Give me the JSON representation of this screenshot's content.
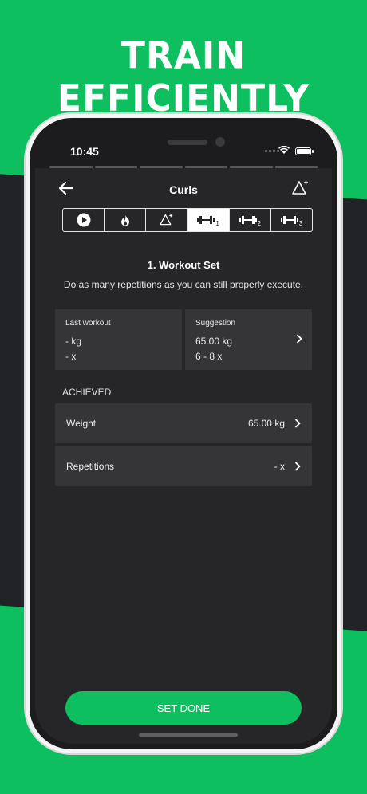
{
  "headline": "TRAIN EFFICIENTLY",
  "status": {
    "time": "10:45"
  },
  "nav": {
    "title": "Curls"
  },
  "segments": [
    {
      "icon": "play-icon",
      "active": false
    },
    {
      "icon": "flame-icon",
      "active": false
    },
    {
      "icon": "triangle-icon",
      "active": false
    },
    {
      "icon": "dumbbell-icon",
      "sub": "1",
      "active": true
    },
    {
      "icon": "dumbbell-icon",
      "sub": "2",
      "active": false
    },
    {
      "icon": "dumbbell-icon",
      "sub": "3",
      "active": false
    }
  ],
  "set": {
    "title": "1. Workout Set",
    "description": "Do as many repetitions as you can still properly execute."
  },
  "last_workout": {
    "label": "Last workout",
    "weight": "- kg",
    "reps": "- x"
  },
  "suggestion": {
    "label": "Suggestion",
    "weight": "65.00 kg",
    "reps": "6 - 8 x"
  },
  "achieved": {
    "label": "ACHIEVED",
    "weight_label": "Weight",
    "weight_value": "65.00 kg",
    "reps_label": "Repetitions",
    "reps_value": "- x"
  },
  "cta_label": "SET DONE",
  "colors": {
    "brand_green": "#0dbf5e",
    "screen_bg": "#262628",
    "card_bg": "#353537"
  }
}
